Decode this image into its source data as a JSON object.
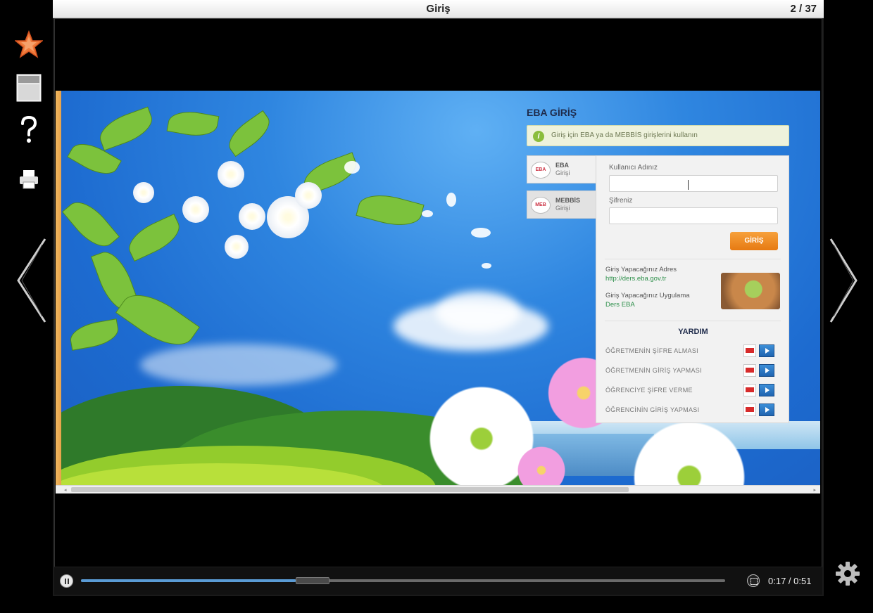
{
  "window": {
    "title": "Giriş",
    "slide_counter": "2 / 37"
  },
  "toolbar": {
    "icons": [
      "star-icon",
      "layout-icon",
      "help-icon",
      "print-icon"
    ],
    "accent_color": "#f07a3a"
  },
  "eba_page": {
    "heading": "EBA GİRİŞ",
    "info_text": "Giriş için EBA ya da MEBBİS girişlerini kullanın",
    "tabs": [
      {
        "badge": "EBA",
        "line1": "EBA",
        "line2": "Girişi"
      },
      {
        "badge": "MEB",
        "line1": "MEBBİS",
        "line2": "Girişi"
      }
    ],
    "username_label": "Kullanıcı Adınız",
    "password_label": "Şifreniz",
    "username_value": "",
    "password_value": "",
    "login_button": "GİRİŞ",
    "address_label": "Giriş Yapacağınız Adres",
    "address_value": "http://ders.eba.gov.tr",
    "app_label": "Giriş Yapacağınız Uygulama",
    "app_value": "Ders EBA",
    "help_title": "YARDIM",
    "help_items": [
      "ÖĞRETMENİN ŞİFRE ALMASI",
      "ÖĞRETMENİN GİRİŞ YAPMASI",
      "ÖĞRENCİYE ŞİFRE VERME",
      "ÖĞRENCİNİN GİRİŞ YAPMASI"
    ],
    "button_color": "#f08a20"
  },
  "player": {
    "time_display": "0:17 / 0:51",
    "progress": 0.333
  }
}
